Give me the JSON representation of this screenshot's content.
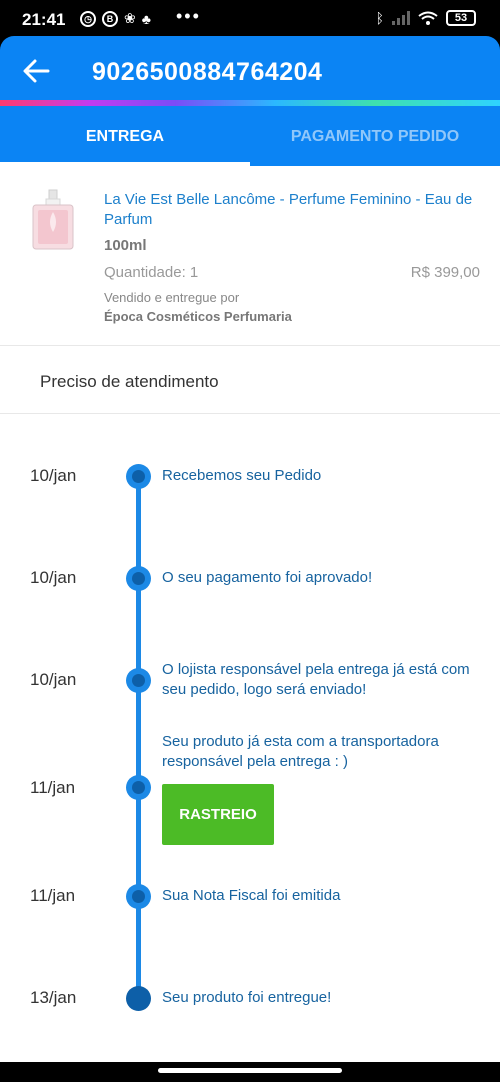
{
  "status_bar": {
    "time": "21:41",
    "left_icons": [
      "alarm-icon",
      "b-icon",
      "app-icon",
      "app-icon-2"
    ],
    "battery": "53"
  },
  "app_bar": {
    "order_number": "9026500884764204",
    "back_icon": "arrow-left-icon"
  },
  "tabs": [
    {
      "label": "ENTREGA",
      "active": true
    },
    {
      "label": "PAGAMENTO PEDIDO",
      "active": false
    }
  ],
  "product": {
    "name": "La Vie Est Belle Lancôme - Perfume Feminino - Eau de Parfum",
    "size": "100ml",
    "quantity": "Quantidade: 1",
    "price": "R$ 399,00",
    "sold_by": "Vendido e entregue por",
    "seller": "Época Cosméticos Perfumaria"
  },
  "help": {
    "label": "Preciso de atendimento"
  },
  "timeline": [
    {
      "date": "10/jan",
      "event": "Recebemos seu Pedido"
    },
    {
      "date": "10/jan",
      "event": "O seu pagamento foi aprovado!"
    },
    {
      "date": "10/jan",
      "event": "O lojista responsável pela entrega já está com seu pedido, logo será enviado!"
    },
    {
      "date": "11/jan",
      "event": "Seu produto já esta com a transportadora responsável pela entrega : )",
      "button": "RASTREIO"
    },
    {
      "date": "11/jan",
      "event": "Sua Nota Fiscal foi emitida"
    },
    {
      "date": "13/jan",
      "event": "Seu produto foi entregue!"
    }
  ],
  "colors": {
    "primary": "#0b84f4",
    "timeline": "#1c89e6",
    "button": "#4cbb26",
    "link": "#1d80cc"
  }
}
